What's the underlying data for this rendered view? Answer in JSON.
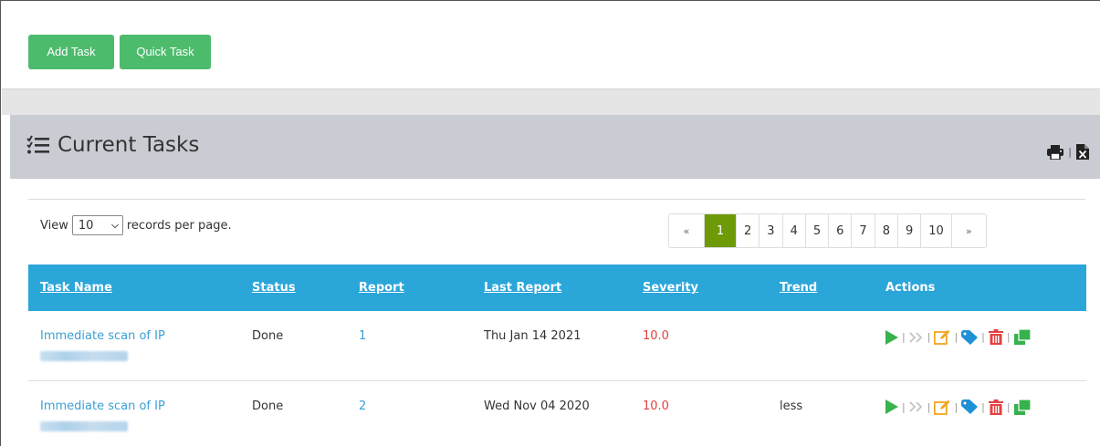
{
  "toolbar": {
    "add_task_label": "Add Task",
    "quick_task_label": "Quick Task",
    "button_color": "#4cbb6c"
  },
  "panel": {
    "title": "Current Tasks",
    "title_icon": "task-list-icon",
    "tools": [
      "print-icon",
      "excel-export-icon"
    ]
  },
  "view": {
    "prefix": "View",
    "selected": "10",
    "suffix": "records per page."
  },
  "pagination": {
    "prev": "«",
    "next": "»",
    "pages": [
      "1",
      "2",
      "3",
      "4",
      "5",
      "6",
      "7",
      "8",
      "9",
      "10"
    ],
    "active": "1",
    "active_color": "#6f9a08"
  },
  "table": {
    "header_color": "#2ba6d9",
    "columns": [
      "Task Name",
      "Status",
      "Report",
      "Last Report",
      "Severity",
      "Trend",
      "Actions"
    ],
    "rows": [
      {
        "task_name": "Immediate scan of IP",
        "status": "Done",
        "report": "1",
        "last_report": "Thu Jan 14 2021",
        "severity": "10.0",
        "trend": ""
      },
      {
        "task_name": "Immediate scan of IP",
        "status": "Done",
        "report": "2",
        "last_report": "Wed Nov 04 2020",
        "severity": "10.0",
        "trend": "less"
      }
    ],
    "actions": [
      "play-icon",
      "fast-forward-icon",
      "edit-icon",
      "tag-icon",
      "delete-icon",
      "clone-icon"
    ]
  },
  "colors": {
    "link": "#3c9fd4",
    "severity_high": "#e34141",
    "panel_header": "#c9ccd3"
  }
}
